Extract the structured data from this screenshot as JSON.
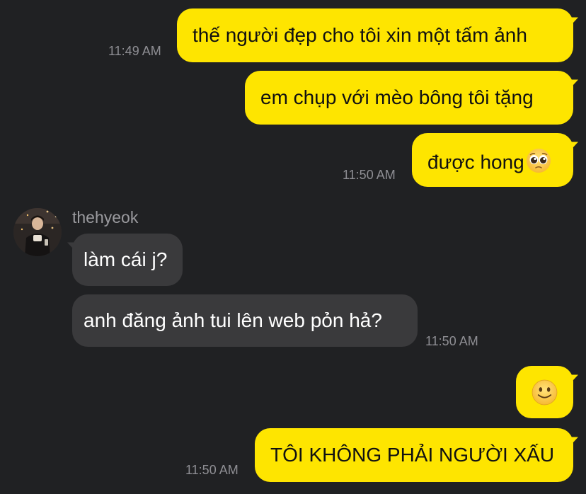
{
  "messages": [
    {
      "text": "thế người đẹp cho tôi xin một tấm ảnh",
      "time": "11:49 AM"
    },
    {
      "text": "em chụp với mèo bông tôi tặng"
    },
    {
      "text": "được hong",
      "emoji": "pleading-face",
      "time": "11:50 AM"
    }
  ],
  "incoming": {
    "sender": "thehyeok",
    "messages": [
      {
        "text": "làm cái j?"
      },
      {
        "text": "anh đăng ảnh tui lên web pỏn hả?",
        "time": "11:50 AM"
      }
    ]
  },
  "replies": [
    {
      "emoji": "slightly-smiling-face"
    },
    {
      "text": "TÔI KHÔNG PHẢI NGƯỜI XẤU",
      "time": "11:50 AM"
    }
  ],
  "colors": {
    "background": "#202123",
    "outgoing_bubble": "#FEE500",
    "incoming_bubble": "#3A3A3C",
    "timestamp": "#8E8E93"
  }
}
